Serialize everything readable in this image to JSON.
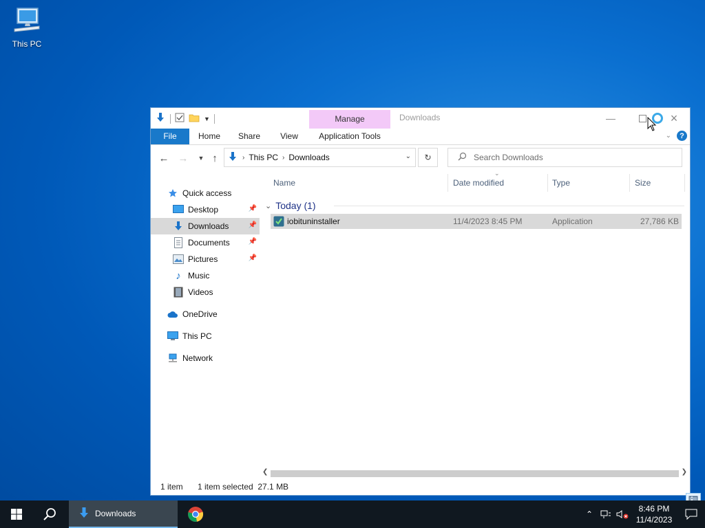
{
  "desktop": {
    "icons": [
      {
        "label": "This PC",
        "icon": "computer-icon"
      }
    ]
  },
  "window": {
    "title": "Downloads",
    "contextual_tab": "Manage",
    "ribbon_tabs": [
      "File",
      "Home",
      "Share",
      "View",
      "Application Tools"
    ],
    "controls": [
      "minimize-icon",
      "maximize-icon",
      "close-icon"
    ]
  },
  "navbar": {
    "breadcrumb": [
      "This PC",
      "Downloads"
    ],
    "search_placeholder": "Search Downloads"
  },
  "navpane": {
    "items": [
      {
        "label": "Quick access",
        "icon": "star-icon",
        "level": 1
      },
      {
        "label": "Desktop",
        "icon": "desktop-icon",
        "level": 2,
        "pinned": true
      },
      {
        "label": "Downloads",
        "icon": "download-arrow-icon",
        "level": 2,
        "pinned": true,
        "selected": true
      },
      {
        "label": "Documents",
        "icon": "documents-icon",
        "level": 2,
        "pinned": true
      },
      {
        "label": "Pictures",
        "icon": "pictures-icon",
        "level": 2,
        "pinned": true
      },
      {
        "label": "Music",
        "icon": "music-icon",
        "level": 2
      },
      {
        "label": "Videos",
        "icon": "videos-icon",
        "level": 2
      },
      {
        "label": "OneDrive",
        "icon": "cloud-icon",
        "level": 1
      },
      {
        "label": "This PC",
        "icon": "computer-icon",
        "level": 1
      },
      {
        "label": "Network",
        "icon": "network-icon",
        "level": 1
      }
    ]
  },
  "content": {
    "columns": [
      "Name",
      "Date modified",
      "Type",
      "Size"
    ],
    "group": "Today (1)",
    "files": [
      {
        "name": "iobituninstaller",
        "date_modified": "11/4/2023 8:45 PM",
        "type": "Application",
        "size": "27,786 KB",
        "selected": true
      }
    ]
  },
  "status": {
    "item_count": "1 item",
    "selection": "1 item selected  27.1 MB"
  },
  "taskbar": {
    "active_task": "Downloads",
    "clock_time": "8:46 PM",
    "clock_date": "11/4/2023"
  },
  "colors": {
    "accent": "#1979ca",
    "manage_tab": "#f3c9f8",
    "selection": "#d9d9d9",
    "taskbar": "#101820"
  }
}
